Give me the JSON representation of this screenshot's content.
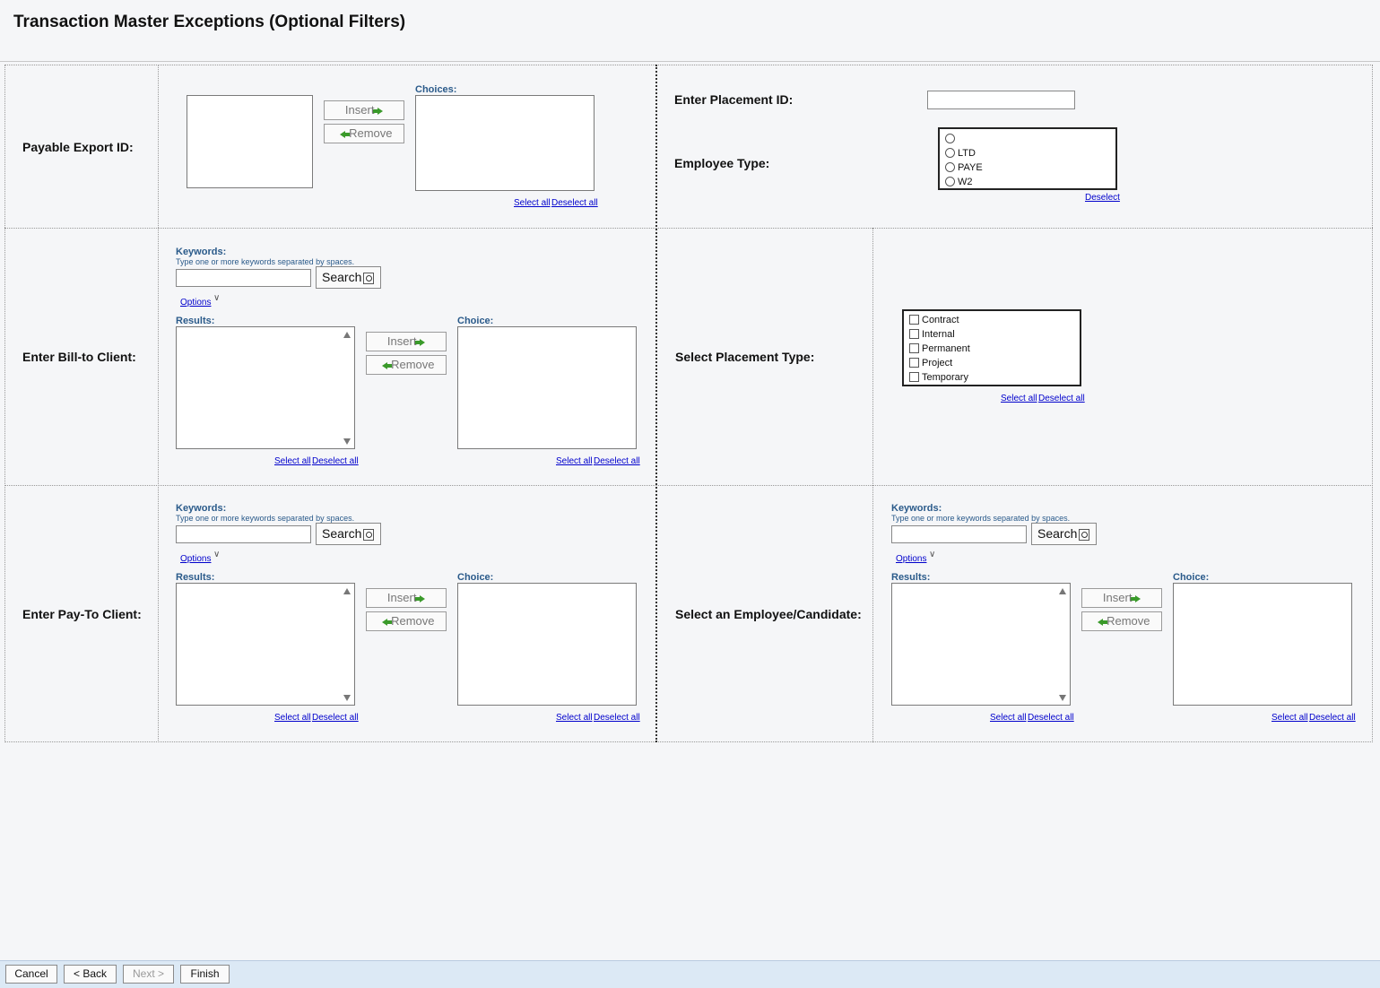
{
  "page": {
    "title": "Transaction Master Exceptions (Optional Filters)"
  },
  "common": {
    "insert": "Insert",
    "remove": "Remove",
    "select_all": "Select all",
    "deselect_all": "Deselect all",
    "deselect": "Deselect",
    "keywords": "Keywords:",
    "keywords_hint": "Type one or more keywords separated by spaces.",
    "search": "Search",
    "options": "Options",
    "results": "Results:",
    "choice": "Choice:",
    "choices": "Choices:"
  },
  "payable_export": {
    "label": "Payable Export ID:"
  },
  "placement_id": {
    "label": "Enter Placement ID:"
  },
  "employee_type": {
    "label": "Employee Type:",
    "options": [
      "",
      "LTD",
      "PAYE",
      "W2"
    ]
  },
  "bill_to": {
    "label": "Enter Bill-to Client:"
  },
  "placement_type": {
    "label": "Select Placement Type:",
    "options": [
      "Contract",
      "Internal",
      "Permanent",
      "Project",
      "Temporary"
    ]
  },
  "pay_to": {
    "label": "Enter Pay-To Client:"
  },
  "employee": {
    "label": "Select an Employee/Candidate:"
  },
  "footer": {
    "cancel": "Cancel",
    "back": "< Back",
    "next": "Next >",
    "finish": "Finish"
  }
}
